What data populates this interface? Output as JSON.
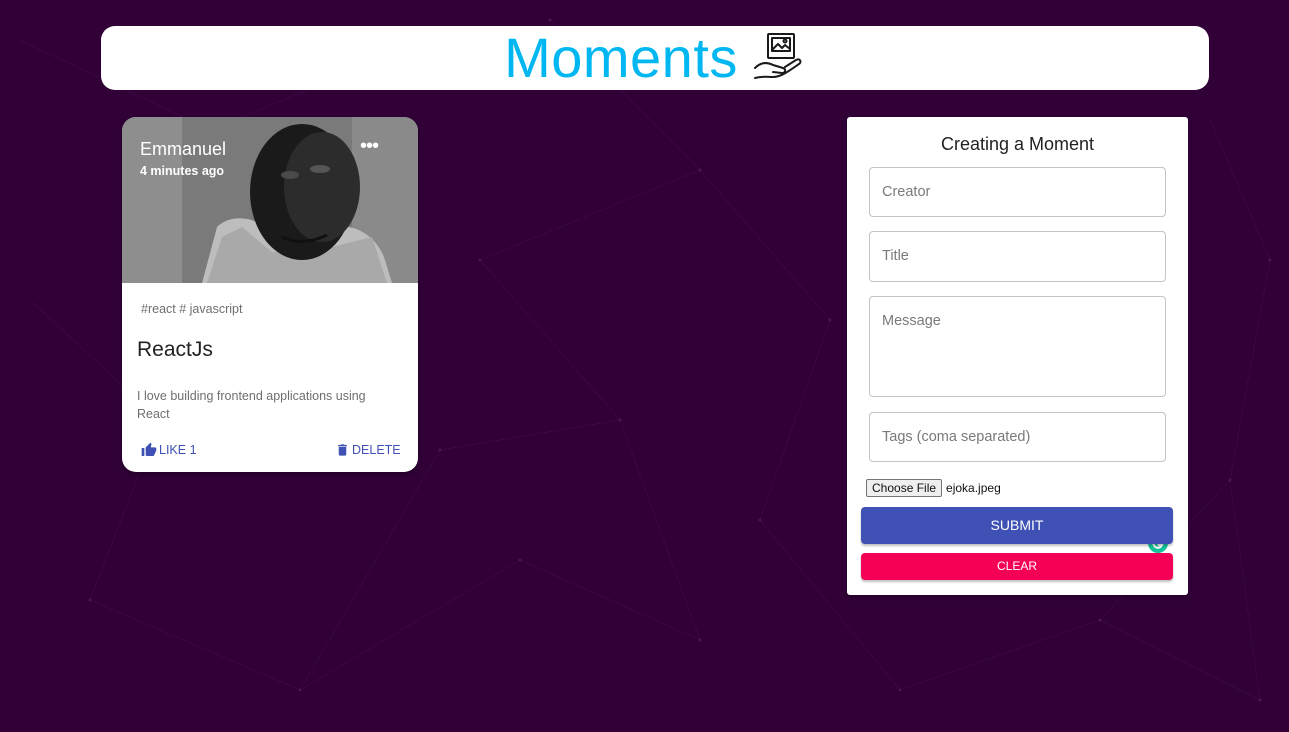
{
  "appbar": {
    "title": "Moments",
    "logo_icon": "hand-holding-picture-icon"
  },
  "colors": {
    "background": "#300037",
    "title": "#00b7f1",
    "primary": "#3f51b5",
    "secondary": "#f50057"
  },
  "post": {
    "creator": "Emmanuel",
    "time_ago": "4 minutes ago",
    "tags": "#react # javascript",
    "title": "ReactJs",
    "message": "I love building frontend applications using React",
    "like_label": "LIKE 1",
    "delete_label": "DELETE",
    "more_icon": "more-horiz-icon"
  },
  "form": {
    "heading": "Creating a Moment",
    "creator_placeholder": "Creator",
    "title_placeholder": "Title",
    "message_placeholder": "Message",
    "tags_placeholder": "Tags (coma separated)",
    "file_button_label": "Choose File",
    "file_name": "ejoka.jpeg",
    "submit_label": "SUBMIT",
    "clear_label": "CLEAR"
  }
}
